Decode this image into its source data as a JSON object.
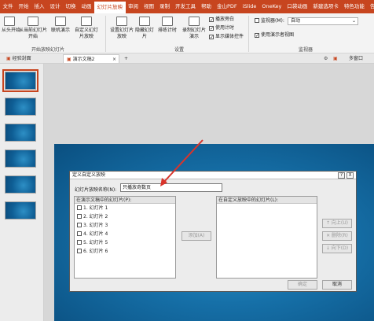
{
  "ribbon_tabs": [
    "文件",
    "开始",
    "插入",
    "设计",
    "切换",
    "动画",
    "幻灯片放映",
    "审阅",
    "视图",
    "录制",
    "开发工具",
    "帮助",
    "金山PDF",
    "iSlide",
    "OneKey",
    "口袋动画",
    "新建选项卡",
    "特色功能",
    "告诉我"
  ],
  "active_tab_index": 6,
  "ribbon": {
    "from_start": "从头开始",
    "from_current": "从当前幻灯片开始",
    "online": "联机演示",
    "custom_show": "自定义幻灯片放映",
    "group_start": "开始放映幻灯片",
    "setup_show": "设置幻灯片放映",
    "hide_slide": "隐藏幻灯片",
    "rehearse": "排练计时",
    "record": "录制幻灯片演示",
    "play_narration": "播放旁白",
    "use_timing": "使用计时",
    "show_media": "显示媒体控件",
    "group_setup": "设置",
    "monitor_label": "监视器(M):",
    "monitor_value": "自动",
    "presenter_view": "使用演示者视图",
    "group_monitor": "监视器"
  },
  "doc_tabs": {
    "tab1": "经验封面",
    "tab2": "演示文稿2",
    "add": "+",
    "right_label": "多窗口"
  },
  "slide_count": 6,
  "selected_slide": 1,
  "dialog": {
    "title": "定义自定义放映",
    "help": "?",
    "close": "X",
    "name_label": "幻灯片放映名称(N):",
    "name_value": "只播放奇数页",
    "left_header": "在演示文稿中的幻灯片(P):",
    "right_header": "在自定义放映中的幻灯片(L):",
    "slides": [
      "1. 幻灯片 1",
      "2. 幻灯片 2",
      "3. 幻灯片 3",
      "4. 幻灯片 4",
      "5. 幻灯片 5",
      "6. 幻灯片 6"
    ],
    "add_button": "添加(A)",
    "up_button": "↑ 向上(U)",
    "delete_button": "✕ 删除(R)",
    "down_button": "↓ 向下(D)",
    "ok_button": "确定",
    "cancel_button": "取消"
  },
  "colors": {
    "accent": "#c7451f",
    "arrow": "#d9342b"
  }
}
